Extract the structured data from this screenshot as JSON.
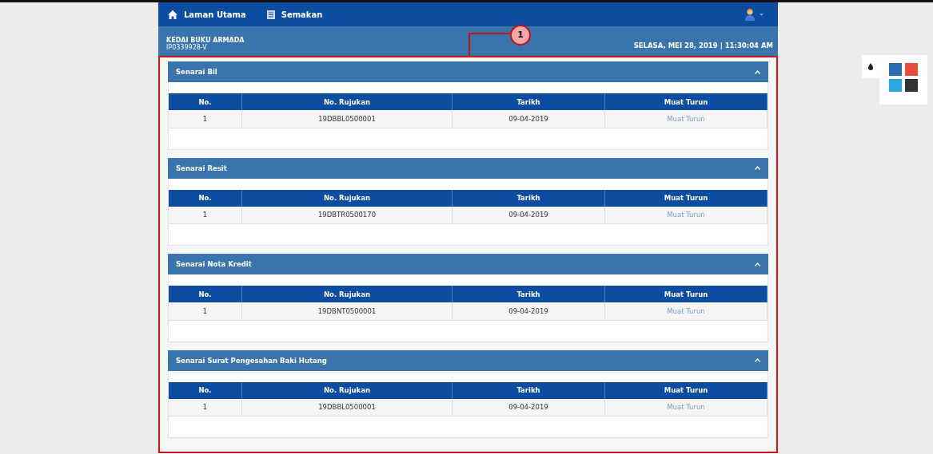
{
  "nav": {
    "items": [
      {
        "label": "Laman Utama"
      },
      {
        "label": "Semakan"
      }
    ]
  },
  "header": {
    "company": "KEDAI BUKU ARMADA",
    "registration": "IP0339928-V",
    "datetime": "SELASA, MEI 28, 2019 | 11:30:04 AM"
  },
  "annotation": {
    "number": "1"
  },
  "sections": [
    {
      "title": "Senarai Bil",
      "expanded": true,
      "columns": [
        "No.",
        "No. Rujukan",
        "Tarikh",
        "Muat Turun"
      ],
      "rows": [
        [
          "1",
          "19DBBL0500001",
          "09-04-2019",
          "Muat Turun"
        ]
      ]
    },
    {
      "title": "Senarai Resit",
      "expanded": true,
      "columns": [
        "No.",
        "No. Rujukan",
        "Tarikh",
        "Muat Turun"
      ],
      "rows": [
        [
          "1",
          "19DBTR0500170",
          "09-04-2019",
          "Muat Turun"
        ]
      ]
    },
    {
      "title": "Senarai Nota Kredit",
      "expanded": true,
      "columns": [
        "No.",
        "No. Rujukan",
        "Tarikh",
        "Muat Turun"
      ],
      "rows": [
        [
          "1",
          "19DBNT0500001",
          "09-04-2019",
          "Muat Turun"
        ]
      ]
    },
    {
      "title": "Senarai Surat Pengesahan Baki Hutang",
      "expanded": true,
      "columns": [
        "No.",
        "No. Rujukan",
        "Tarikh",
        "Muat Turun"
      ],
      "rows": [
        [
          "1",
          "19DBBL0500001",
          "09-04-2019",
          "Muat Turun"
        ]
      ]
    }
  ],
  "theme_swatches": [
    {
      "color": "#2a6db0"
    },
    {
      "color": "#e94c3d"
    },
    {
      "color": "#29a7e1"
    },
    {
      "color": "#333333"
    }
  ]
}
